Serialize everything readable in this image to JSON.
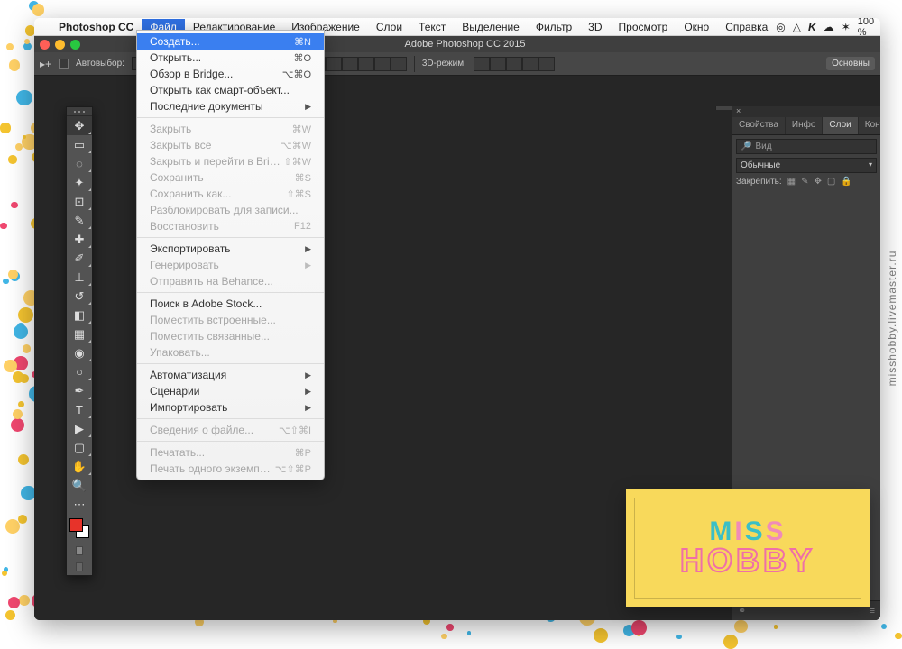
{
  "app_name": "Photoshop CC",
  "window_title": "Adobe Photoshop CC 2015",
  "battery_pct": "100 %",
  "menu": [
    "Файл",
    "Редактирование",
    "Изображение",
    "Слои",
    "Текст",
    "Выделение",
    "Фильтр",
    "3D",
    "Просмотр",
    "Окно",
    "Справка"
  ],
  "active_menu_index": 0,
  "file_menu": [
    {
      "label": "Создать...",
      "sc": "⌘N",
      "hl": true
    },
    {
      "label": "Открыть...",
      "sc": "⌘O"
    },
    {
      "label": "Обзор в Bridge...",
      "sc": "⌥⌘O"
    },
    {
      "label": "Открыть как смарт-объект..."
    },
    {
      "label": "Последние документы",
      "sub": true
    },
    {
      "sep": true
    },
    {
      "label": "Закрыть",
      "sc": "⌘W",
      "dim": true
    },
    {
      "label": "Закрыть все",
      "sc": "⌥⌘W",
      "dim": true
    },
    {
      "label": "Закрыть и перейти в Bridge...",
      "sc": "⇧⌘W",
      "dim": true
    },
    {
      "label": "Сохранить",
      "sc": "⌘S",
      "dim": true
    },
    {
      "label": "Сохранить как...",
      "sc": "⇧⌘S",
      "dim": true
    },
    {
      "label": "Разблокировать для записи...",
      "dim": true
    },
    {
      "label": "Восстановить",
      "sc": "F12",
      "dim": true
    },
    {
      "sep": true
    },
    {
      "label": "Экспортировать",
      "sub": true
    },
    {
      "label": "Генерировать",
      "sub": true,
      "dim": true
    },
    {
      "label": "Отправить на Behance...",
      "dim": true
    },
    {
      "sep": true
    },
    {
      "label": "Поиск в Adobe Stock..."
    },
    {
      "label": "Поместить встроенные...",
      "dim": true
    },
    {
      "label": "Поместить связанные...",
      "dim": true
    },
    {
      "label": "Упаковать...",
      "dim": true
    },
    {
      "sep": true
    },
    {
      "label": "Автоматизация",
      "sub": true
    },
    {
      "label": "Сценарии",
      "sub": true
    },
    {
      "label": "Импортировать",
      "sub": true
    },
    {
      "sep": true
    },
    {
      "label": "Сведения о файле...",
      "sc": "⌥⇧⌘I",
      "dim": true
    },
    {
      "sep": true
    },
    {
      "label": "Печатать...",
      "sc": "⌘P",
      "dim": true
    },
    {
      "label": "Печать одного экземпляра",
      "sc": "⌥⇧⌘P",
      "dim": true
    }
  ],
  "optbar": {
    "autoselect": "Автовыбор:",
    "mode": "3D-режим:",
    "essentials": "Основны"
  },
  "panels": {
    "tabs": [
      "Свойства",
      "Инфо",
      "Слои",
      "Контуры"
    ],
    "active_tab_index": 2,
    "search_placeholder": "Вид",
    "blend": "Обычные",
    "lock_label": "Закрепить:"
  },
  "watermark_side": "misshobby.livemaster.ru",
  "card": {
    "line1": "MISS",
    "line2": "HOBBY"
  }
}
